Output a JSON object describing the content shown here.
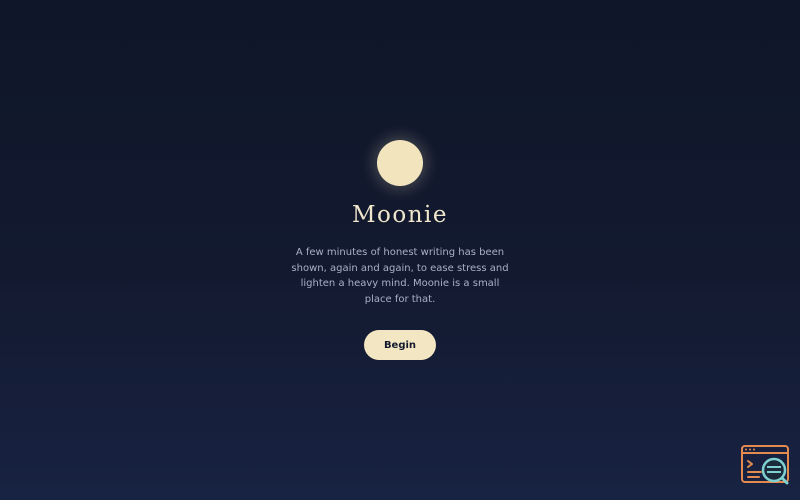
{
  "app": {
    "title": "Moonie",
    "tagline": "A few minutes of honest writing has been shown, again and again, to ease stress and lighten a heavy mind. Moonie is a small place for that."
  },
  "actions": {
    "begin_label": "Begin"
  },
  "icons": {
    "moon": "moon-icon",
    "corner_widget": "devtools-inspect-icon"
  },
  "colors": {
    "background_top": "#0f1629",
    "background_bottom": "#182242",
    "moon": "#f2e5bd",
    "title": "#efe6cc",
    "body_text": "#a8b0c8",
    "button_bg": "#f3e6c2",
    "button_text": "#121a2e",
    "widget_orange": "#e38b4f",
    "widget_teal": "#7fd0d0"
  }
}
